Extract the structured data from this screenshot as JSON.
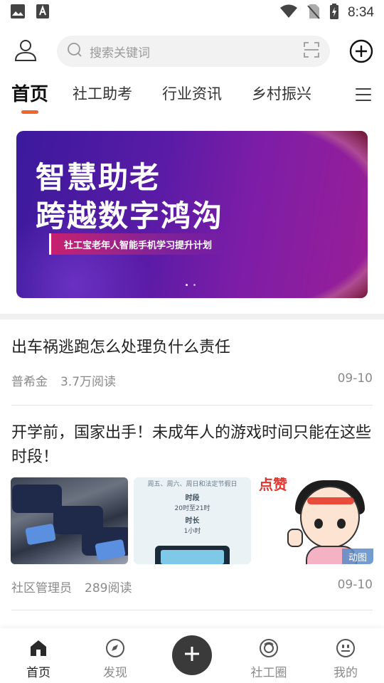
{
  "status_bar": {
    "time": "8:34",
    "icons": [
      "image-icon",
      "font-icon",
      "wifi-icon",
      "no-sim-icon",
      "battery-charging-icon"
    ]
  },
  "header": {
    "search_placeholder": "搜索关键词",
    "icons": [
      "user-icon",
      "search-icon",
      "scan-icon",
      "add-circle-icon"
    ]
  },
  "tabs": [
    {
      "label": "首页",
      "active": true
    },
    {
      "label": "社工助考",
      "active": false
    },
    {
      "label": "行业资讯",
      "active": false
    },
    {
      "label": "乡村振兴",
      "active": false
    }
  ],
  "banner": {
    "line1": "智慧助老",
    "line2": "跨越数字鸿沟",
    "tag": "社工宝老年人智能手机学习提升计划",
    "slides_total": 2,
    "current_slide": 1
  },
  "articles": [
    {
      "title": "出车祸逃跑怎么处理负什么责任",
      "author": "普希金",
      "reads": "3.7万阅读",
      "date": "09-10"
    },
    {
      "title": "开学前，国家出手！未成年人的游戏时间只能在这些时段！",
      "author": "社区管理员",
      "reads": "289阅读",
      "date": "09-10",
      "thumb2": {
        "header": "周五、周六、周日和法定节假日",
        "period_label": "时段",
        "period_value": "20时至21时",
        "duration_label": "时长",
        "duration_value": "1小时"
      },
      "thumb3": {
        "word": "点赞",
        "badge": "动图"
      }
    }
  ],
  "bottom_nav": [
    {
      "label": "首页",
      "icon": "home-icon",
      "active": true
    },
    {
      "label": "发现",
      "icon": "discover-icon",
      "active": false
    },
    {
      "label": "社工圈",
      "icon": "circle-icon",
      "active": false
    },
    {
      "label": "我的",
      "icon": "profile-icon",
      "active": false
    }
  ],
  "colors": {
    "accent": "#f2652a",
    "nav_active": "#222222",
    "nav_inactive": "#8a8a8a",
    "publish_button": "#3a3a3a"
  }
}
